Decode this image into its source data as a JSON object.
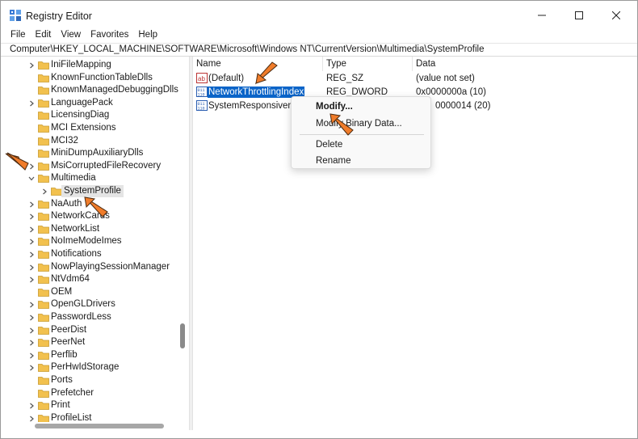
{
  "window": {
    "title": "Registry Editor",
    "controls": {
      "minimize": "minimize",
      "maximize": "maximize",
      "close": "close"
    }
  },
  "menu": {
    "file": "File",
    "edit": "Edit",
    "view": "View",
    "favorites": "Favorites",
    "help": "Help"
  },
  "address": "Computer\\HKEY_LOCAL_MACHINE\\SOFTWARE\\Microsoft\\Windows NT\\CurrentVersion\\Multimedia\\SystemProfile",
  "tree": {
    "items": [
      {
        "label": "IniFileMapping",
        "expandable": true
      },
      {
        "label": "KnownFunctionTableDlls",
        "expandable": false
      },
      {
        "label": "KnownManagedDebuggingDlls",
        "expandable": false
      },
      {
        "label": "LanguagePack",
        "expandable": true
      },
      {
        "label": "LicensingDiag",
        "expandable": false
      },
      {
        "label": "MCI Extensions",
        "expandable": false
      },
      {
        "label": "MCI32",
        "expandable": false
      },
      {
        "label": "MiniDumpAuxiliaryDlls",
        "expandable": false
      },
      {
        "label": "MsiCorruptedFileRecovery",
        "expandable": true
      },
      {
        "label": "Multimedia",
        "expandable": true,
        "expanded": true
      },
      {
        "label": "SystemProfile",
        "expandable": true,
        "child": true,
        "selected": true
      },
      {
        "label": "NaAuth",
        "expandable": true
      },
      {
        "label": "NetworkCards",
        "expandable": true
      },
      {
        "label": "NetworkList",
        "expandable": true
      },
      {
        "label": "NoImeModeImes",
        "expandable": true
      },
      {
        "label": "Notifications",
        "expandable": true
      },
      {
        "label": "NowPlayingSessionManager",
        "expandable": true
      },
      {
        "label": "NtVdm64",
        "expandable": true
      },
      {
        "label": "OEM",
        "expandable": false
      },
      {
        "label": "OpenGLDrivers",
        "expandable": true
      },
      {
        "label": "PasswordLess",
        "expandable": true
      },
      {
        "label": "PeerDist",
        "expandable": true
      },
      {
        "label": "PeerNet",
        "expandable": true
      },
      {
        "label": "Perflib",
        "expandable": true
      },
      {
        "label": "PerHwIdStorage",
        "expandable": true
      },
      {
        "label": "Ports",
        "expandable": false
      },
      {
        "label": "Prefetcher",
        "expandable": false
      },
      {
        "label": "Print",
        "expandable": true
      },
      {
        "label": "ProfileList",
        "expandable": true
      }
    ]
  },
  "values": {
    "headers": {
      "name": "Name",
      "type": "Type",
      "data": "Data"
    },
    "rows": [
      {
        "name": "(Default)",
        "type": "REG_SZ",
        "data": "(value not set)",
        "icon": "string-value-icon"
      },
      {
        "name": "NetworkThrottlingIndex",
        "type": "REG_DWORD",
        "data": "0x0000000a (10)",
        "icon": "binary-value-icon",
        "selected": true
      },
      {
        "name": "SystemResponsivene",
        "type": "",
        "data": "0000014 (20)",
        "icon": "binary-value-icon"
      }
    ]
  },
  "context_menu": {
    "modify": "Modify...",
    "modify_binary": "Modify Binary Data...",
    "delete": "Delete",
    "rename": "Rename"
  },
  "colors": {
    "accent_arrow": "#f07c2a",
    "selection": "#0a64c8",
    "folder": "#f2c14e"
  }
}
